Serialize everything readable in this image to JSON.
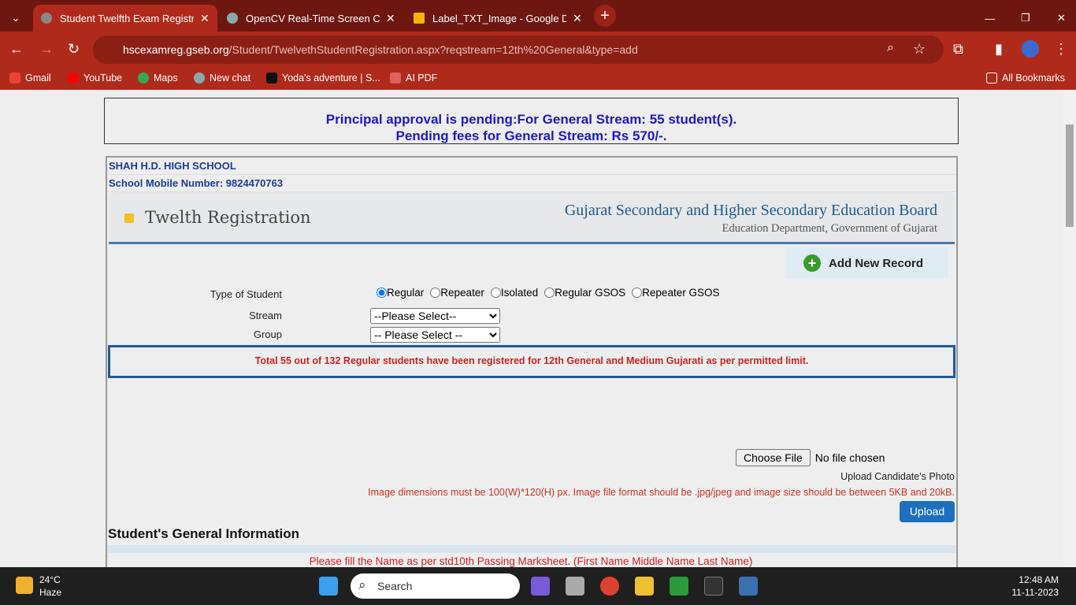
{
  "browser": {
    "tabs": [
      {
        "label": "Student Twelfth Exam Registrati",
        "active": true
      },
      {
        "label": "OpenCV Real-Time Screen Capt",
        "active": false
      },
      {
        "label": "Label_TXT_Image - Google Driv",
        "active": false
      }
    ],
    "url_host": "hscexamreg.gseb.org",
    "url_path": "/Student/TwelvethStudentRegistration.aspx?reqstream=12th%20General&type=add",
    "bookmarks": [
      "Gmail",
      "YouTube",
      "Maps",
      "New chat",
      "Yoda's adventure | S...",
      "AI PDF"
    ],
    "all_bookmarks": "All Bookmarks"
  },
  "notice": {
    "line1": "Principal approval is pending:For General Stream: 55 student(s).",
    "line2": "Pending fees for General Stream: Rs 570/-."
  },
  "school": {
    "name": "SHAH H.D. HIGH SCHOOL",
    "mobile": "School Mobile Number: 9824470763"
  },
  "header": {
    "title": "Twelth Registration",
    "board": "Gujarat Secondary and Higher Secondary Education Board",
    "dept": "Education Department, Government of Gujarat"
  },
  "add_record": "Add New Record",
  "form": {
    "type_label": "Type of Student",
    "types": [
      "Regular",
      "Repeater",
      "Isolated",
      "Regular GSOS",
      "Repeater GSOS"
    ],
    "selected_type": "Regular",
    "stream_label": "Stream",
    "stream_value": "--Please Select--",
    "group_label": "Group",
    "group_value": "-- Please Select --"
  },
  "limit_msg": "Total 55 out of 132 Regular students have been registered for 12th General and Medium Gujarati as per permitted limit.",
  "photo": {
    "choose": "Choose File",
    "none": "No file chosen",
    "label": "Upload Candidate's Photo",
    "rule": "Image dimensions must be 100(W)*120(H) px. Image file format should be .jpg/jpeg and image size should be between 5KB and 20kB.",
    "upload": "Upload"
  },
  "section_title": "Student's General Information",
  "name_note": "Please fill the Name as per std10th Passing Marksheet. (First Name Middle Name Last Name)",
  "taskbar": {
    "temp": "24°C",
    "weather": "Haze",
    "search": "Search",
    "time": "12:48 AM",
    "date": "11-11-2023"
  },
  "colors": {
    "tabstrip": "#6e1710",
    "toolbar": "#b02a1c",
    "notice_text": "#1a1acc",
    "error_text": "#cc2222"
  }
}
